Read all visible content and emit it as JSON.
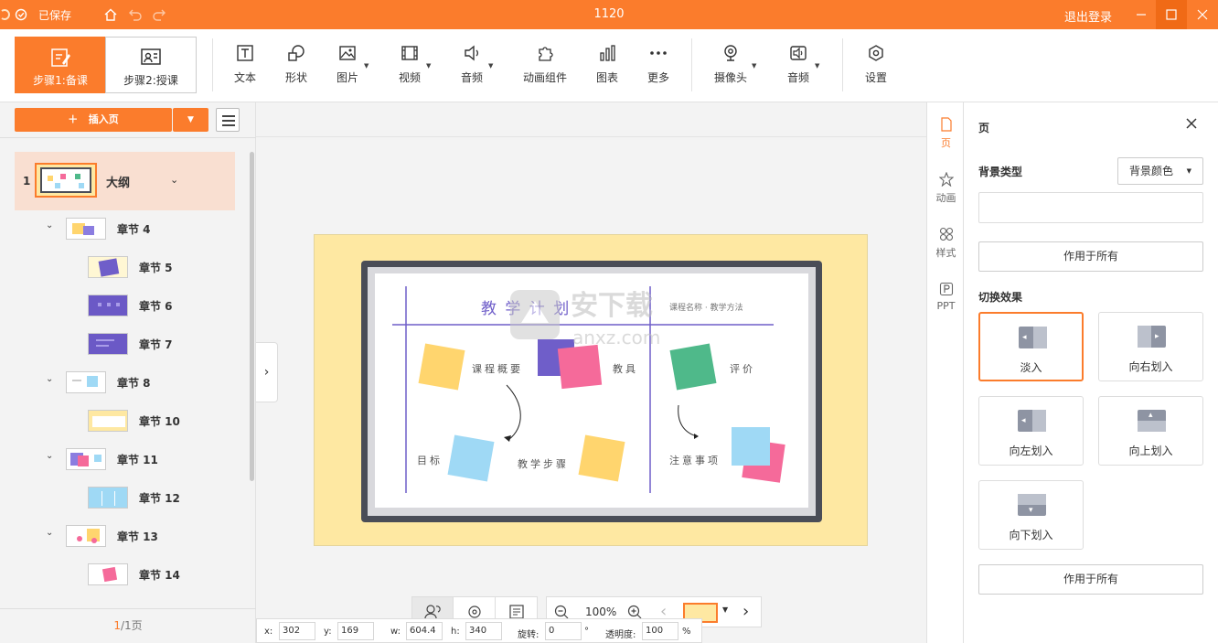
{
  "titlebar": {
    "saved": "已保存",
    "doc_title": "1120",
    "logout": "退出登录"
  },
  "steps": [
    {
      "label": "步骤1:备课"
    },
    {
      "label": "步骤2:授课"
    }
  ],
  "tools": [
    {
      "label": "文本",
      "icon": "text-icon"
    },
    {
      "label": "形状",
      "icon": "shape-icon"
    },
    {
      "label": "图片",
      "icon": "image-icon"
    },
    {
      "label": "视频",
      "icon": "video-icon"
    },
    {
      "label": "音频",
      "icon": "audio-icon"
    },
    {
      "label": "动画组件",
      "icon": "puzzle-icon"
    },
    {
      "label": "图表",
      "icon": "chart-icon"
    },
    {
      "label": "更多",
      "icon": "more-icon"
    },
    {
      "label": "摄像头",
      "icon": "camera-icon"
    },
    {
      "label": "音频",
      "icon": "audio-record-icon"
    },
    {
      "label": "设置",
      "icon": "settings-icon"
    }
  ],
  "sidebar": {
    "insert_page": "插入页",
    "page": {
      "num": "1",
      "name": "大纲"
    },
    "sections": [
      {
        "label": "章节 4",
        "level": 1
      },
      {
        "label": "章节 5",
        "level": 2
      },
      {
        "label": "章节 6",
        "level": 2
      },
      {
        "label": "章节 7",
        "level": 2
      },
      {
        "label": "章节 8",
        "level": 1
      },
      {
        "label": "章节 10",
        "level": 2
      },
      {
        "label": "章节 11",
        "level": 1
      },
      {
        "label": "章节 12",
        "level": 2
      },
      {
        "label": "章节 13",
        "level": 1
      },
      {
        "label": "章节 14",
        "level": 2
      }
    ],
    "footer_current": "1",
    "footer_total": "/1页"
  },
  "canvas": {
    "slide_title": "教 学 计 划",
    "slide_subtitle": "课程名称 · 教学方法",
    "labels": {
      "course": "课程概要",
      "teach": "教具",
      "eval": "评价",
      "goal": "目标",
      "steps": "教学步骤",
      "notes": "注意事项"
    },
    "watermark_text": "安下载",
    "watermark_url": "anxz.com",
    "zoom": "100%"
  },
  "coords": {
    "x_label": "x:",
    "x": "302",
    "y_label": "y:",
    "y": "169",
    "w_label": "w:",
    "w": "604.4",
    "h_label": "h:",
    "h": "340",
    "rot_label": "旋转:",
    "rot": "0",
    "rot_unit": "°",
    "op_label": "透明度:",
    "op": "100",
    "op_unit": "%"
  },
  "right_tabs": [
    {
      "label": "页",
      "icon": "page-icon"
    },
    {
      "label": "动画",
      "icon": "animation-icon"
    },
    {
      "label": "样式",
      "icon": "style-icon"
    },
    {
      "label": "PPT",
      "icon": "ppt-icon"
    }
  ],
  "props": {
    "title": "页",
    "bg_type_label": "背景类型",
    "bg_type_value": "背景颜色",
    "apply_all": "作用于所有",
    "transition_label": "切换效果",
    "effects": [
      {
        "label": "淡入"
      },
      {
        "label": "向右划入"
      },
      {
        "label": "向左划入"
      },
      {
        "label": "向上划入"
      },
      {
        "label": "向下划入"
      }
    ],
    "apply_all_2": "作用于所有"
  },
  "colors": {
    "accent": "#fb7c2c",
    "slide_bg": "#fee8a2",
    "board": "#4a4d57"
  }
}
